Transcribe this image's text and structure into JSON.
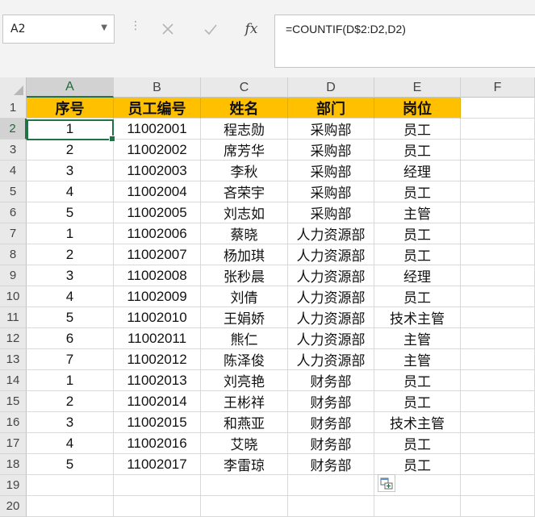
{
  "name_box": {
    "value": "A2"
  },
  "formula_bar": {
    "fx_label": "fx",
    "formula": "=COUNTIF(D$2:D2,D2)"
  },
  "columns": [
    "A",
    "B",
    "C",
    "D",
    "E",
    "F"
  ],
  "row_numbers": [
    "1",
    "2",
    "3",
    "4",
    "5",
    "6",
    "7",
    "8",
    "9",
    "10",
    "11",
    "12",
    "13",
    "14",
    "15",
    "16",
    "17",
    "18",
    "19",
    "20"
  ],
  "header_row": [
    "序号",
    "员工编号",
    "姓名",
    "部门",
    "岗位"
  ],
  "rows": [
    [
      "1",
      "11002001",
      "程志勋",
      "采购部",
      "员工"
    ],
    [
      "2",
      "11002002",
      "席芳华",
      "采购部",
      "员工"
    ],
    [
      "3",
      "11002003",
      "李秋",
      "采购部",
      "经理"
    ],
    [
      "4",
      "11002004",
      "吝荣宇",
      "采购部",
      "员工"
    ],
    [
      "5",
      "11002005",
      "刘志如",
      "采购部",
      "主管"
    ],
    [
      "1",
      "11002006",
      "蔡晓",
      "人力资源部",
      "员工"
    ],
    [
      "2",
      "11002007",
      "杨加琪",
      "人力资源部",
      "员工"
    ],
    [
      "3",
      "11002008",
      "张秒晨",
      "人力资源部",
      "经理"
    ],
    [
      "4",
      "11002009",
      "刘倩",
      "人力资源部",
      "员工"
    ],
    [
      "5",
      "11002010",
      "王娟娇",
      "人力资源部",
      "技术主管"
    ],
    [
      "6",
      "11002011",
      "熊仁",
      "人力资源部",
      "主管"
    ],
    [
      "7",
      "11002012",
      "陈泽俊",
      "人力资源部",
      "主管"
    ],
    [
      "1",
      "11002013",
      "刘亮艳",
      "财务部",
      "员工"
    ],
    [
      "2",
      "11002014",
      "王彬祥",
      "财务部",
      "员工"
    ],
    [
      "3",
      "11002015",
      "和燕亚",
      "财务部",
      "技术主管"
    ],
    [
      "4",
      "11002016",
      "艾晓",
      "财务部",
      "员工"
    ],
    [
      "5",
      "11002017",
      "李雷琼",
      "财务部",
      "员工"
    ]
  ],
  "colors": {
    "header_fill": "#ffc000",
    "selection": "#217346"
  }
}
